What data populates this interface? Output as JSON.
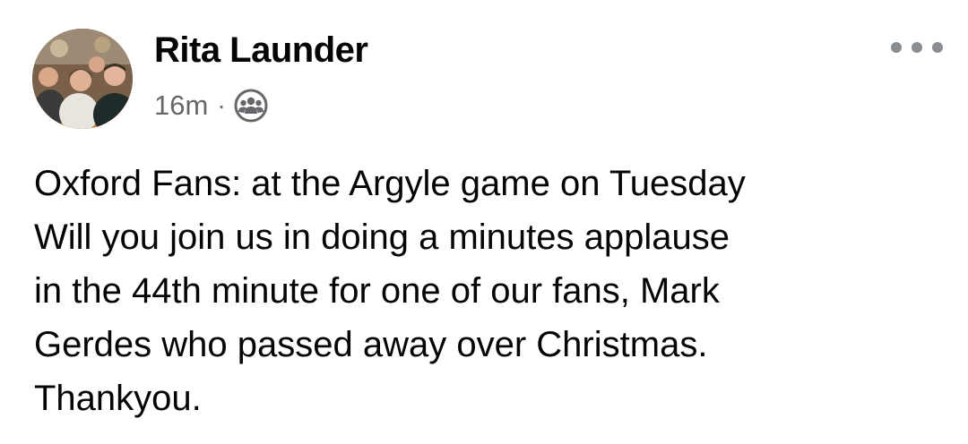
{
  "post": {
    "author": "Rita Launder",
    "time": "16m",
    "separator": "·",
    "audience_icon": "group-icon",
    "more_icon": "more-options-icon",
    "text_lines": [
      "Oxford Fans: at the Argyle game on Tuesday",
      "Will you join us in doing a minutes applause",
      "in the 44th minute for one of our fans, Mark",
      "Gerdes who passed away over Christmas.",
      "Thankyou."
    ]
  },
  "colors": {
    "text": "#050505",
    "secondary_text": "#65676b",
    "icon_gray": "#8a8d91",
    "background": "#ffffff"
  }
}
